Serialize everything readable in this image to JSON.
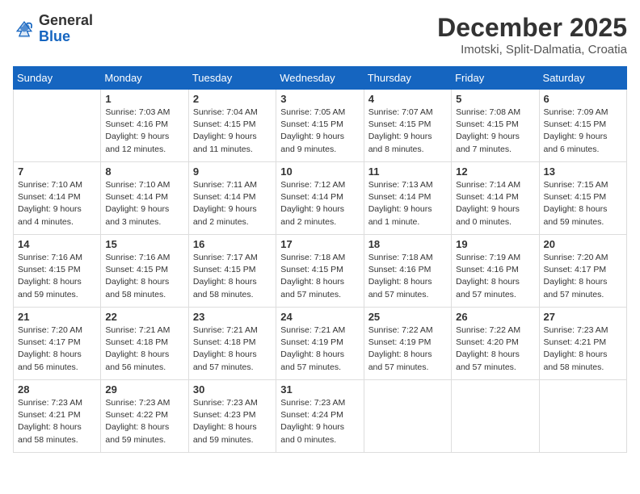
{
  "header": {
    "logo_general": "General",
    "logo_blue": "Blue",
    "month_title": "December 2025",
    "location": "Imotski, Split-Dalmatia, Croatia"
  },
  "days_of_week": [
    "Sunday",
    "Monday",
    "Tuesday",
    "Wednesday",
    "Thursday",
    "Friday",
    "Saturday"
  ],
  "weeks": [
    [
      {
        "day": "",
        "info": ""
      },
      {
        "day": "1",
        "info": "Sunrise: 7:03 AM\nSunset: 4:16 PM\nDaylight: 9 hours\nand 12 minutes."
      },
      {
        "day": "2",
        "info": "Sunrise: 7:04 AM\nSunset: 4:15 PM\nDaylight: 9 hours\nand 11 minutes."
      },
      {
        "day": "3",
        "info": "Sunrise: 7:05 AM\nSunset: 4:15 PM\nDaylight: 9 hours\nand 9 minutes."
      },
      {
        "day": "4",
        "info": "Sunrise: 7:07 AM\nSunset: 4:15 PM\nDaylight: 9 hours\nand 8 minutes."
      },
      {
        "day": "5",
        "info": "Sunrise: 7:08 AM\nSunset: 4:15 PM\nDaylight: 9 hours\nand 7 minutes."
      },
      {
        "day": "6",
        "info": "Sunrise: 7:09 AM\nSunset: 4:15 PM\nDaylight: 9 hours\nand 6 minutes."
      }
    ],
    [
      {
        "day": "7",
        "info": "Sunrise: 7:10 AM\nSunset: 4:14 PM\nDaylight: 9 hours\nand 4 minutes."
      },
      {
        "day": "8",
        "info": "Sunrise: 7:10 AM\nSunset: 4:14 PM\nDaylight: 9 hours\nand 3 minutes."
      },
      {
        "day": "9",
        "info": "Sunrise: 7:11 AM\nSunset: 4:14 PM\nDaylight: 9 hours\nand 2 minutes."
      },
      {
        "day": "10",
        "info": "Sunrise: 7:12 AM\nSunset: 4:14 PM\nDaylight: 9 hours\nand 2 minutes."
      },
      {
        "day": "11",
        "info": "Sunrise: 7:13 AM\nSunset: 4:14 PM\nDaylight: 9 hours\nand 1 minute."
      },
      {
        "day": "12",
        "info": "Sunrise: 7:14 AM\nSunset: 4:14 PM\nDaylight: 9 hours\nand 0 minutes."
      },
      {
        "day": "13",
        "info": "Sunrise: 7:15 AM\nSunset: 4:15 PM\nDaylight: 8 hours\nand 59 minutes."
      }
    ],
    [
      {
        "day": "14",
        "info": "Sunrise: 7:16 AM\nSunset: 4:15 PM\nDaylight: 8 hours\nand 59 minutes."
      },
      {
        "day": "15",
        "info": "Sunrise: 7:16 AM\nSunset: 4:15 PM\nDaylight: 8 hours\nand 58 minutes."
      },
      {
        "day": "16",
        "info": "Sunrise: 7:17 AM\nSunset: 4:15 PM\nDaylight: 8 hours\nand 58 minutes."
      },
      {
        "day": "17",
        "info": "Sunrise: 7:18 AM\nSunset: 4:15 PM\nDaylight: 8 hours\nand 57 minutes."
      },
      {
        "day": "18",
        "info": "Sunrise: 7:18 AM\nSunset: 4:16 PM\nDaylight: 8 hours\nand 57 minutes."
      },
      {
        "day": "19",
        "info": "Sunrise: 7:19 AM\nSunset: 4:16 PM\nDaylight: 8 hours\nand 57 minutes."
      },
      {
        "day": "20",
        "info": "Sunrise: 7:20 AM\nSunset: 4:17 PM\nDaylight: 8 hours\nand 57 minutes."
      }
    ],
    [
      {
        "day": "21",
        "info": "Sunrise: 7:20 AM\nSunset: 4:17 PM\nDaylight: 8 hours\nand 56 minutes."
      },
      {
        "day": "22",
        "info": "Sunrise: 7:21 AM\nSunset: 4:18 PM\nDaylight: 8 hours\nand 56 minutes."
      },
      {
        "day": "23",
        "info": "Sunrise: 7:21 AM\nSunset: 4:18 PM\nDaylight: 8 hours\nand 57 minutes."
      },
      {
        "day": "24",
        "info": "Sunrise: 7:21 AM\nSunset: 4:19 PM\nDaylight: 8 hours\nand 57 minutes."
      },
      {
        "day": "25",
        "info": "Sunrise: 7:22 AM\nSunset: 4:19 PM\nDaylight: 8 hours\nand 57 minutes."
      },
      {
        "day": "26",
        "info": "Sunrise: 7:22 AM\nSunset: 4:20 PM\nDaylight: 8 hours\nand 57 minutes."
      },
      {
        "day": "27",
        "info": "Sunrise: 7:23 AM\nSunset: 4:21 PM\nDaylight: 8 hours\nand 58 minutes."
      }
    ],
    [
      {
        "day": "28",
        "info": "Sunrise: 7:23 AM\nSunset: 4:21 PM\nDaylight: 8 hours\nand 58 minutes."
      },
      {
        "day": "29",
        "info": "Sunrise: 7:23 AM\nSunset: 4:22 PM\nDaylight: 8 hours\nand 59 minutes."
      },
      {
        "day": "30",
        "info": "Sunrise: 7:23 AM\nSunset: 4:23 PM\nDaylight: 8 hours\nand 59 minutes."
      },
      {
        "day": "31",
        "info": "Sunrise: 7:23 AM\nSunset: 4:24 PM\nDaylight: 9 hours\nand 0 minutes."
      },
      {
        "day": "",
        "info": ""
      },
      {
        "day": "",
        "info": ""
      },
      {
        "day": "",
        "info": ""
      }
    ]
  ]
}
